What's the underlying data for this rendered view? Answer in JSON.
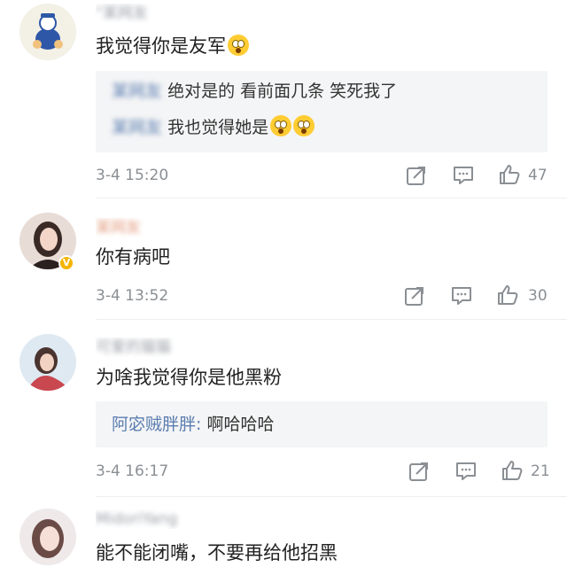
{
  "comments": [
    {
      "username": "\"某网友",
      "content": "我觉得你是友军",
      "replies": [
        {
          "name": "某网友",
          "text": "绝对是的 看前面几条 笑死我了"
        },
        {
          "name": "某网友",
          "text": "我也觉得她是"
        }
      ],
      "time": "3-4 15:20",
      "likes": "47"
    },
    {
      "username": "某网友",
      "content": "你有病吧",
      "replies": [],
      "time": "3-4 13:52",
      "likes": "30",
      "verified": "V"
    },
    {
      "username": "可爱的猫猫",
      "content": "为啥我觉得你是他黑粉",
      "replies": [
        {
          "name": "阿宓贼胖胖:",
          "text": "啊哈哈哈"
        }
      ],
      "time": "3-4 16:17",
      "likes": "21"
    },
    {
      "username": "MidoriYang",
      "content": "能不能闭嘴，不要再给他招黑",
      "replies": [],
      "time": "",
      "likes": ""
    }
  ],
  "icons": {
    "share": "share-icon",
    "comment": "comment-icon",
    "like": "thumbs-up-icon",
    "emoji": "shocked-face-emoji"
  },
  "colors": {
    "reply_name": "#5b7db0",
    "meta": "#8a8f94",
    "reply_bg": "#f4f5f6"
  }
}
